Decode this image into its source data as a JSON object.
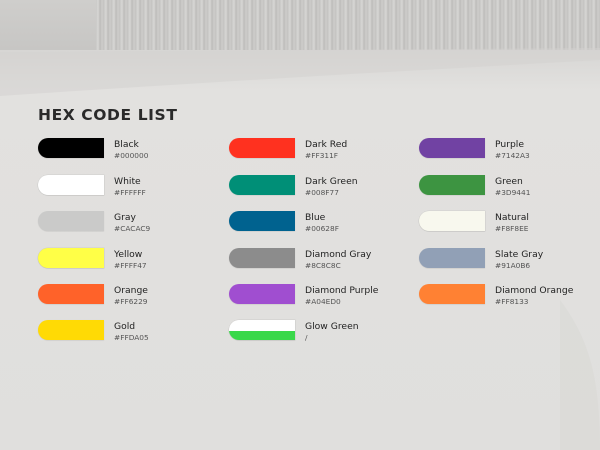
{
  "title": "HEX CODE LIST",
  "columns": [
    [
      {
        "name": "Black",
        "hex": "#000000",
        "color": "#000000"
      },
      {
        "name": "White",
        "hex": "#FFFFFF",
        "color": "#FFFFFF"
      },
      {
        "name": "Gray",
        "hex": "#CACAC9",
        "color": "#CACAC9"
      },
      {
        "name": "Yellow",
        "hex": "#FFFF47",
        "color": "#FFFF47"
      },
      {
        "name": "Orange",
        "hex": "#FF6229",
        "color": "#FF6229"
      },
      {
        "name": "Gold",
        "hex": "#FFDA05",
        "color": "#FFDA05"
      }
    ],
    [
      {
        "name": "Dark Red",
        "hex": "#FF311F",
        "color": "#FF311F"
      },
      {
        "name": "Dark Green",
        "hex": "#008F77",
        "color": "#008F77"
      },
      {
        "name": "Blue",
        "hex": "#00628F",
        "color": "#00628F"
      },
      {
        "name": "Diamond Gray",
        "hex": "#8C8C8C",
        "color": "#8C8C8C"
      },
      {
        "name": "Diamond Purple",
        "hex": "#A04ED0",
        "color": "#A04ED0"
      },
      {
        "name": "Glow Green",
        "hex": "/",
        "color": "#FFFFFF",
        "color_bottom": "#39D84A"
      }
    ],
    [
      {
        "name": "Purple",
        "hex": "#7142A3",
        "color": "#7142A3"
      },
      {
        "name": "Green",
        "hex": "#3D9441",
        "color": "#3D9441"
      },
      {
        "name": "Natural",
        "hex": "#F8F8EE",
        "color": "#F8F8EE"
      },
      {
        "name": "Slate Gray",
        "hex": "#91A0B6",
        "color": "#91A0B6"
      },
      {
        "name": "Diamond Orange",
        "hex": "#FF8133",
        "color": "#FF8133"
      }
    ]
  ]
}
